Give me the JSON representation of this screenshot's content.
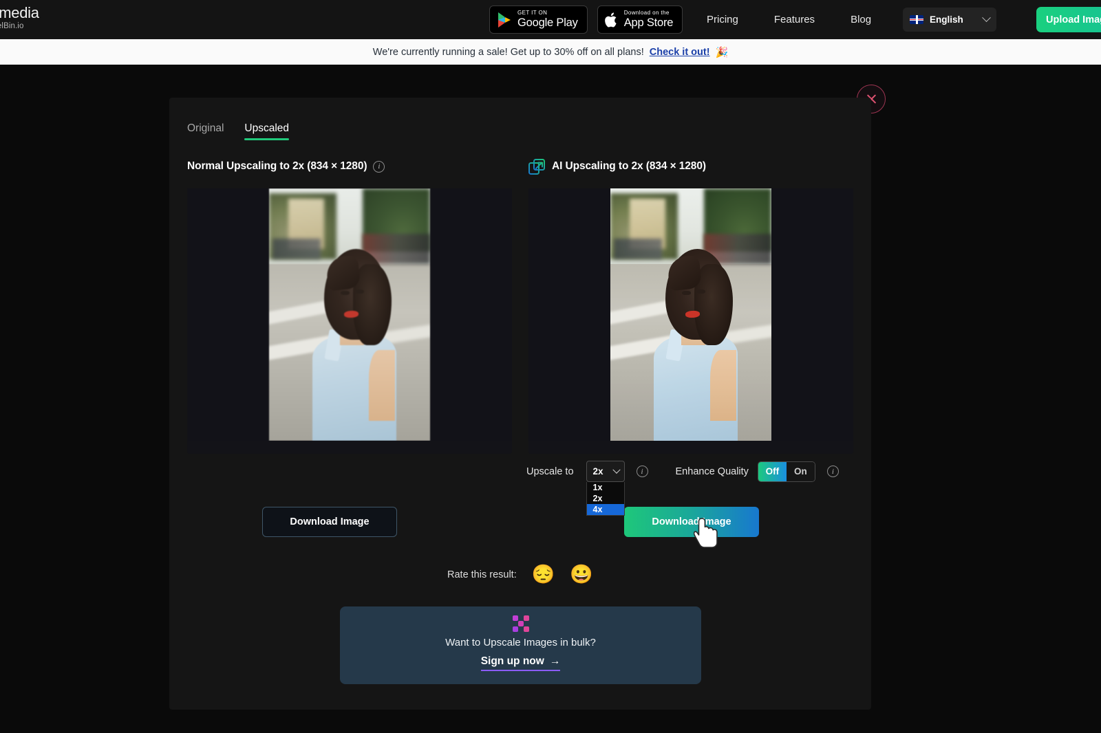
{
  "header": {
    "logo_main": "ale.media",
    "logo_sub": "by PixelBin.io",
    "badges": [
      {
        "top": "GET IT ON",
        "bottom": "Google Play"
      },
      {
        "top": "Download on the",
        "bottom": "App Store"
      }
    ],
    "nav": [
      {
        "label": "Pricing"
      },
      {
        "label": "Features"
      },
      {
        "label": "Blog"
      }
    ],
    "language": "English",
    "upload_button": "Upload Image"
  },
  "promo_bar": {
    "text": "We're currently running a sale! Get up to 30% off on all plans!",
    "link": "Check it out!",
    "emoji": "🎉"
  },
  "modal": {
    "close_label": "Close",
    "tabs": [
      {
        "label": "Original",
        "active": false
      },
      {
        "label": "Upscaled",
        "active": true
      }
    ],
    "left_panel": {
      "title": "Normal Upscaling to 2x (834 × 1280)",
      "download_label": "Download Image"
    },
    "right_panel": {
      "title": "AI Upscaling to 2x (834 × 1280)",
      "download_label": "Download Image"
    },
    "controls": {
      "upscale_label": "Upscale to",
      "upscale_value": "2x",
      "upscale_options": [
        "1x",
        "2x",
        "4x"
      ],
      "upscale_highlighted": "4x",
      "enhance_label": "Enhance Quality",
      "enhance_off": "Off",
      "enhance_on": "On",
      "enhance_state": "Off"
    },
    "rate": {
      "label": "Rate this result:",
      "sad_emoji": "😔",
      "happy_emoji": "😀"
    },
    "bulk_card": {
      "title": "Want to Upscale Images in bulk?",
      "cta": "Sign up now",
      "arrow": "→"
    }
  },
  "colors": {
    "accent_green": "#21c97b",
    "accent_blue": "#1878cf",
    "close_pink": "#e05372",
    "promo_link_blue": "#1a3fa8",
    "card_bg": "#25394a",
    "cta_underline": "#8b5cf6",
    "dropdown_highlight": "#1668d8"
  }
}
